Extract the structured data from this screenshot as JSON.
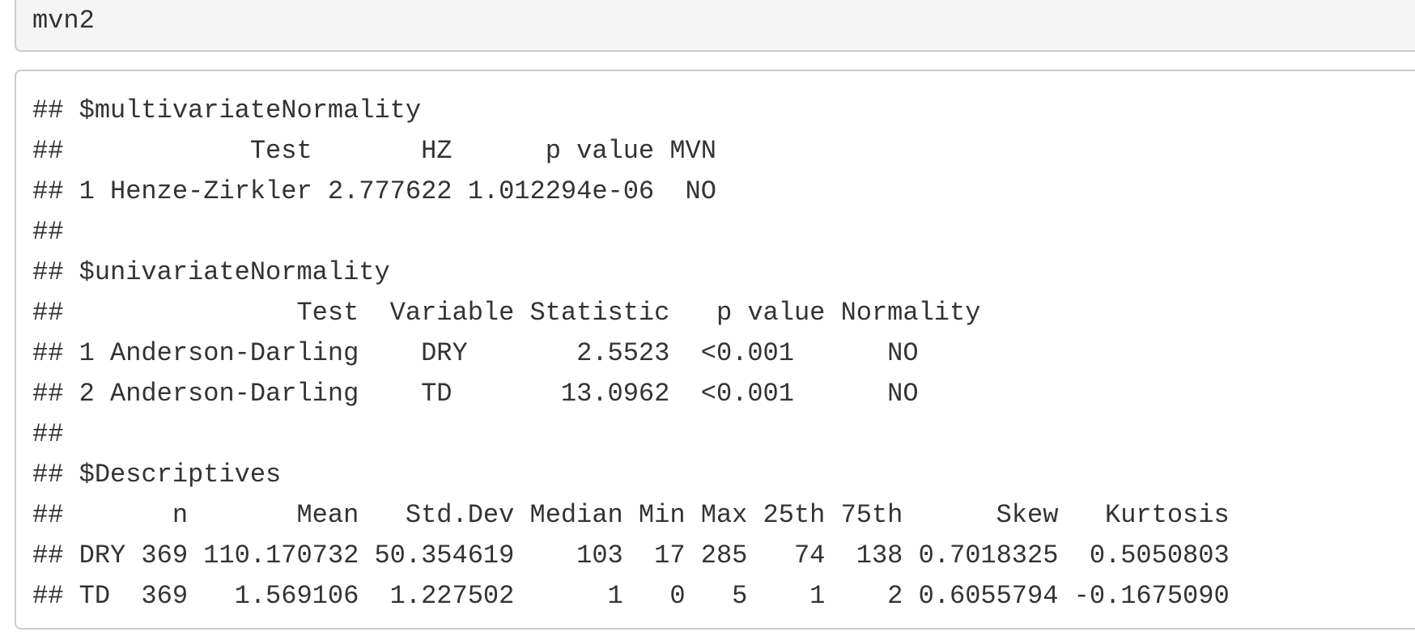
{
  "source_chunk": {
    "code": "mvn2"
  },
  "output_chunk": {
    "lines": [
      "## $multivariateNormality",
      "##            Test       HZ      p value MVN",
      "## 1 Henze-Zirkler 2.777622 1.012294e-06  NO",
      "##",
      "## $univariateNormality",
      "##               Test  Variable Statistic   p value Normality",
      "## 1 Anderson-Darling    DRY       2.5523  <0.001      NO",
      "## 2 Anderson-Darling    TD       13.0962  <0.001      NO",
      "##",
      "## $Descriptives",
      "##       n       Mean   Std.Dev Median Min Max 25th 75th      Skew   Kurtosis",
      "## DRY 369 110.170732 50.354619    103  17 285   74  138 0.7018325  0.5050803",
      "## TD  369   1.569106  1.227502      1   0   5    1    2 0.6055794 -0.1675090"
    ]
  }
}
